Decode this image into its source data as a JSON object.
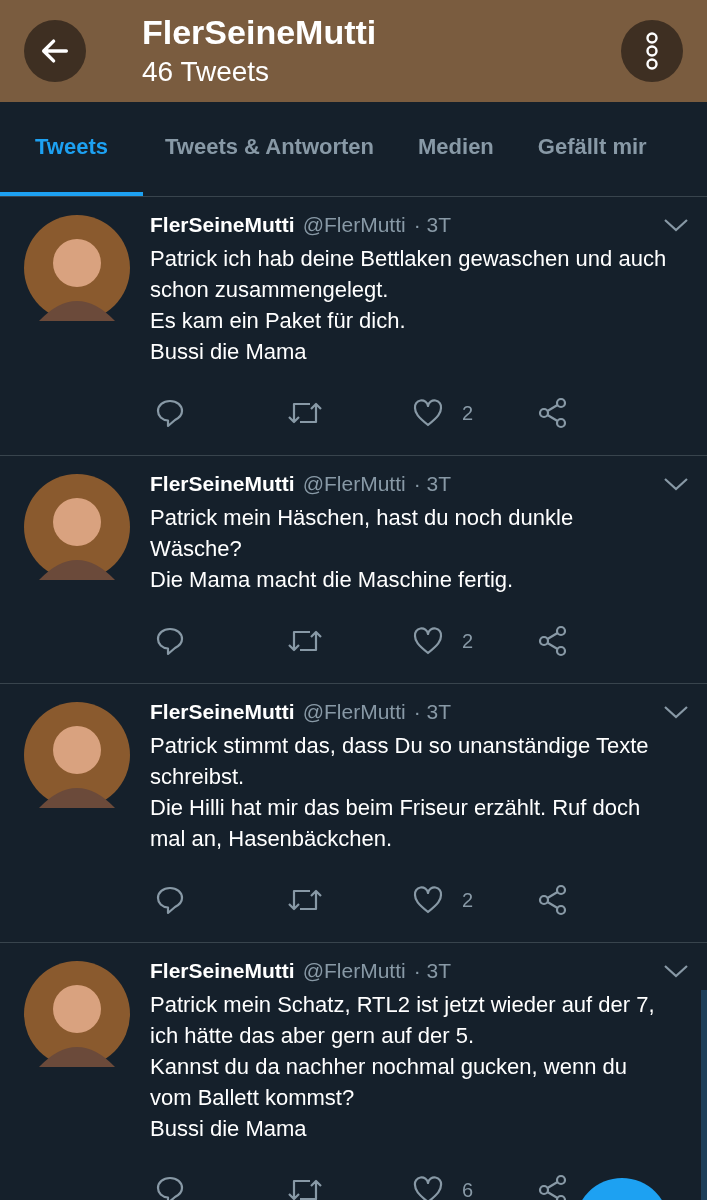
{
  "header": {
    "title": "FlerSeineMutti",
    "subtitle": "46 Tweets"
  },
  "tabs": [
    {
      "label": "Tweets",
      "selected": true
    },
    {
      "label": "Tweets & Antworten",
      "selected": false
    },
    {
      "label": "Medien",
      "selected": false
    },
    {
      "label": "Gefällt mir",
      "selected": false
    }
  ],
  "tweets": [
    {
      "name": "FlerSeineMutti",
      "handle": "@FlerMutti",
      "time": "· 3T",
      "paragraphs": [
        "Patrick ich hab deine Bettlaken gewaschen und auch schon zusammengelegt.",
        "Es kam ein Paket für dich.",
        "Bussi die Mama"
      ],
      "likes": "2"
    },
    {
      "name": "FlerSeineMutti",
      "handle": "@FlerMutti",
      "time": "· 3T",
      "paragraphs": [
        "Patrick mein Häschen, hast du noch dunkle Wäsche?",
        "Die Mama macht die Maschine fertig."
      ],
      "likes": "2"
    },
    {
      "name": "FlerSeineMutti",
      "handle": "@FlerMutti",
      "time": "· 3T",
      "paragraphs": [
        "Patrick stimmt das, dass Du so unanständige Texte schreibst.",
        "Die Hilli hat mir das beim Friseur erzählt. Ruf doch mal an, Hasenbäckchen."
      ],
      "likes": "2"
    },
    {
      "name": "FlerSeineMutti",
      "handle": "@FlerMutti",
      "time": "· 3T",
      "paragraphs": [
        "Patrick mein Schatz, RTL2 ist jetzt wieder auf der 7, ich hätte das aber gern auf der 5.",
        "Kannst du da nachher nochmal gucken, wenn du vom Ballett kommst?",
        "Bussi die Mama"
      ],
      "likes": "6"
    }
  ]
}
